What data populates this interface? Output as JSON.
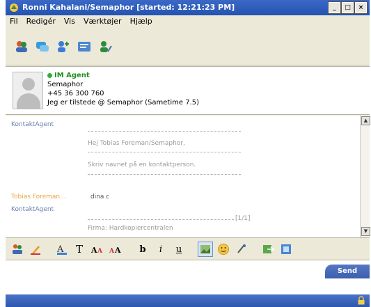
{
  "window": {
    "title": "Ronni Kahalani/Semaphor [started: 12:21:23 PM]",
    "controls": {
      "minimize": "_",
      "maximize": "□",
      "close": "×"
    }
  },
  "menu": {
    "items": [
      "Fil",
      "Redigér",
      "Vis",
      "Værktøjer",
      "Hjælp"
    ]
  },
  "toolbar_icons": [
    "users-icon",
    "chat-bubbles-icon",
    "add-contact-icon",
    "contacts-list-icon",
    "user-edit-icon"
  ],
  "contact": {
    "status": "IM Agent",
    "company": "Semaphor",
    "phone": "+45 36 300 760",
    "meeting": "Jeg er tilstede @ Semaphor (Sametime 7.5)"
  },
  "chat": {
    "sender_agent": "KontaktAgent",
    "line1": "Hej Tobias Foreman/Semaphor,",
    "line2": "Skriv navnet på en kontaktperson.",
    "sender_tobias": "Tobias Foreman...",
    "tobias_msg": "dina c",
    "sender_agent2": "KontaktAgent",
    "counter": "[1/1]",
    "line3": "Firma: Hardkopiercentralen"
  },
  "format_toolbar": {
    "bold": "b",
    "italic": "i",
    "underline": "u"
  },
  "send_button": "Send"
}
